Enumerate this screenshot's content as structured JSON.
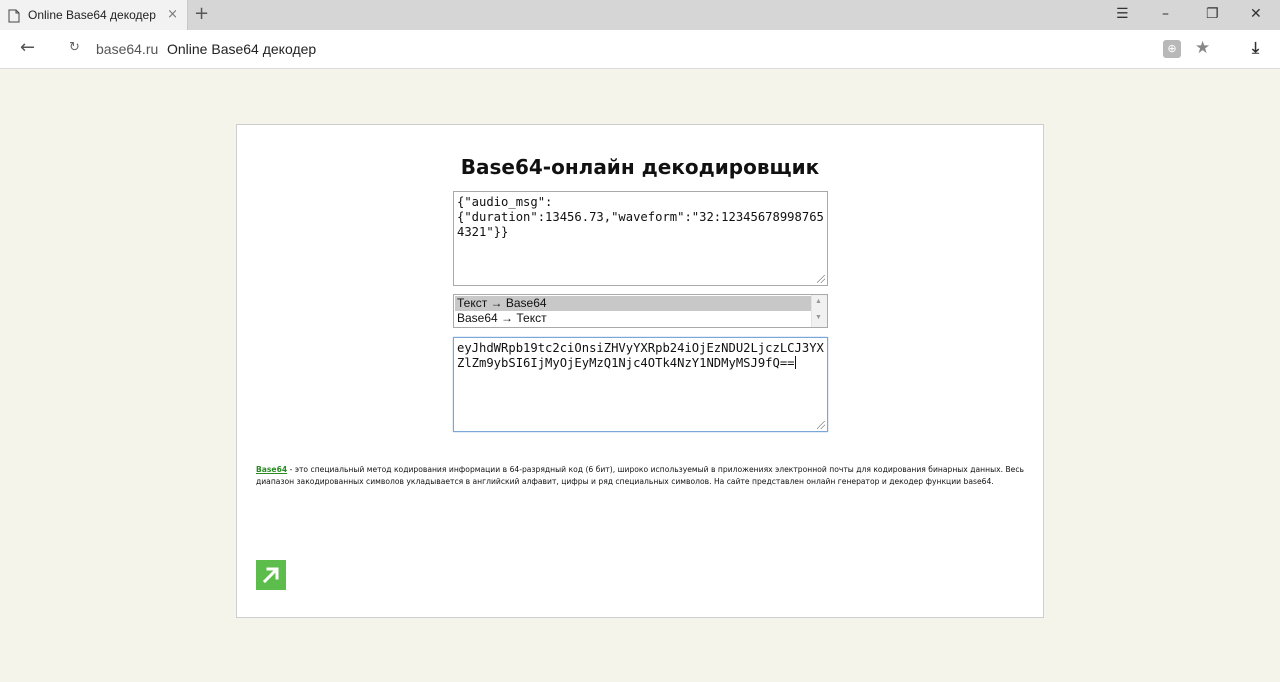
{
  "browser": {
    "tab_title": "Online Base64 декодер",
    "tab_close": "×",
    "new_tab": "+",
    "menu": "☰",
    "minimize": "–",
    "maximize": "❐",
    "close": "✕",
    "back": "←",
    "reload": "↻",
    "url_domain": "base64.ru",
    "url_title": "Online Base64 декодер",
    "protect_icon_glyph": "⊕",
    "star": "★",
    "download": "⤓"
  },
  "page": {
    "title": "Base64-онлайн декодировщик",
    "input_text": "{\"audio_msg\":\n{\"duration\":13456.73,\"waveform\":\"32:123456789987654321\"}}",
    "mode_options": [
      "Текст → Base64",
      "Base64 → Текст"
    ],
    "selected_mode_index": 0,
    "output_text": "eyJhdWRpb19tc2ciOnsiZHVyYXRpb24iOjEzNDU2LjczLCJ3YXZlZm9ybSI6IjMyOjEyMzQ1Njc4OTk4NzY1NDMyMSJ9fQ==",
    "description_link": "Base64",
    "description_text": " - это специальный метод кодирования информации в 64-разрядный код (6 бит), широко используемый в приложениях электронной почты для кодирования бинарных данных. Весь диапазон закодированных символов укладывается в английский алфавит, цифры и ряд специальных символов. На сайте представлен онлайн генератор и декодер функции base64."
  },
  "colors": {
    "page_bg": "#f5f4ea",
    "accent_green": "#5dbd4c",
    "link_green": "#2a8a23"
  },
  "icons": [
    "page-icon",
    "reload-icon",
    "protect-icon",
    "star-icon",
    "download-icon",
    "share-arrow-icon"
  ]
}
